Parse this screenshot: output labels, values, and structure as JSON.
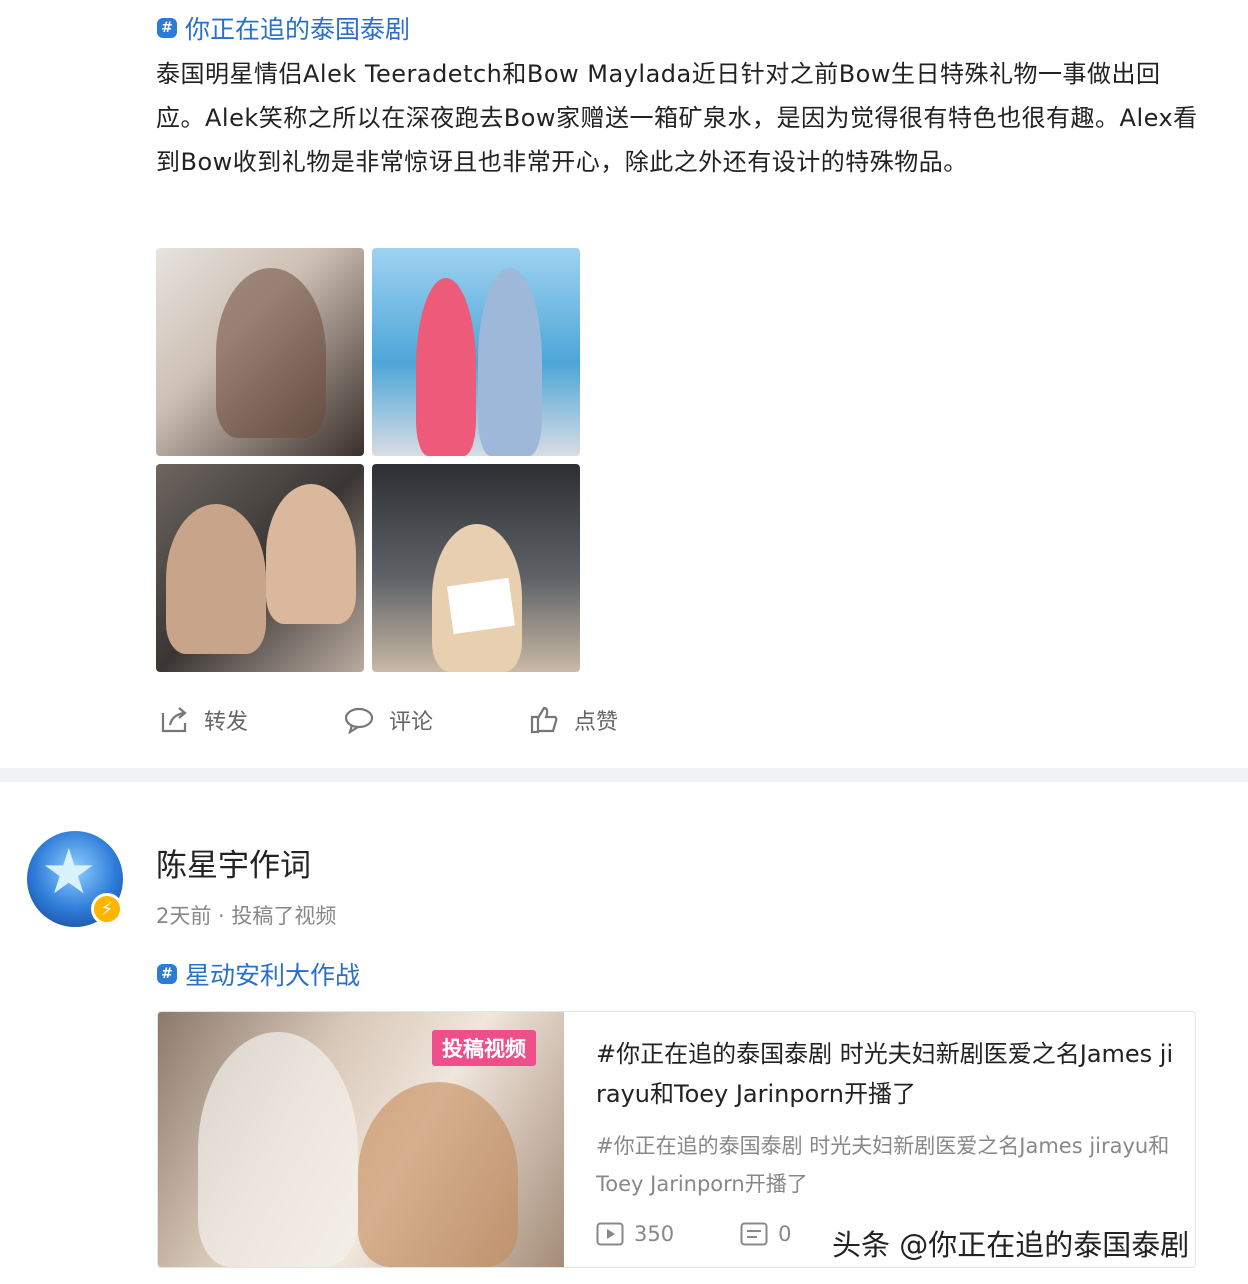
{
  "post1": {
    "topic": "你正在追的泰国泰剧",
    "text": "泰国明星情侣Alek Teeradetch和Bow Maylada近日针对之前Bow生日特殊礼物一事做出回应。Alek笑称之所以在深夜跑去Bow家赠送一箱矿泉水，是因为觉得很有特色也很有趣。Alex看到Bow收到礼物是非常惊讶且也非常开心，除此之外还有设计的特殊物品。",
    "actions": {
      "repost": "转发",
      "comment": "评论",
      "like": "点赞"
    }
  },
  "post2": {
    "username": "陈星宇作词",
    "meta": "2天前 · 投稿了视频",
    "topic": "星动安利大作战",
    "video": {
      "tag": "投稿视频",
      "title": "#你正在追的泰国泰剧 时光夫妇新剧医爱之名James jirayu和Toey Jarinporn开播了",
      "desc": "#你正在追的泰国泰剧 时光夫妇新剧医爱之名James jirayu和Toey Jarinporn开播了",
      "plays": "350",
      "comments": "0"
    }
  },
  "watermark": "头条 @你正在追的泰国泰剧",
  "colors": {
    "link": "#2a6fc9",
    "tag": "#ee4f8a",
    "badge": "#ffb400"
  },
  "icons": [
    "topic-hash-icon",
    "repost-icon",
    "comment-icon",
    "like-icon",
    "play-icon",
    "danmaku-icon",
    "vip-badge-icon"
  ]
}
